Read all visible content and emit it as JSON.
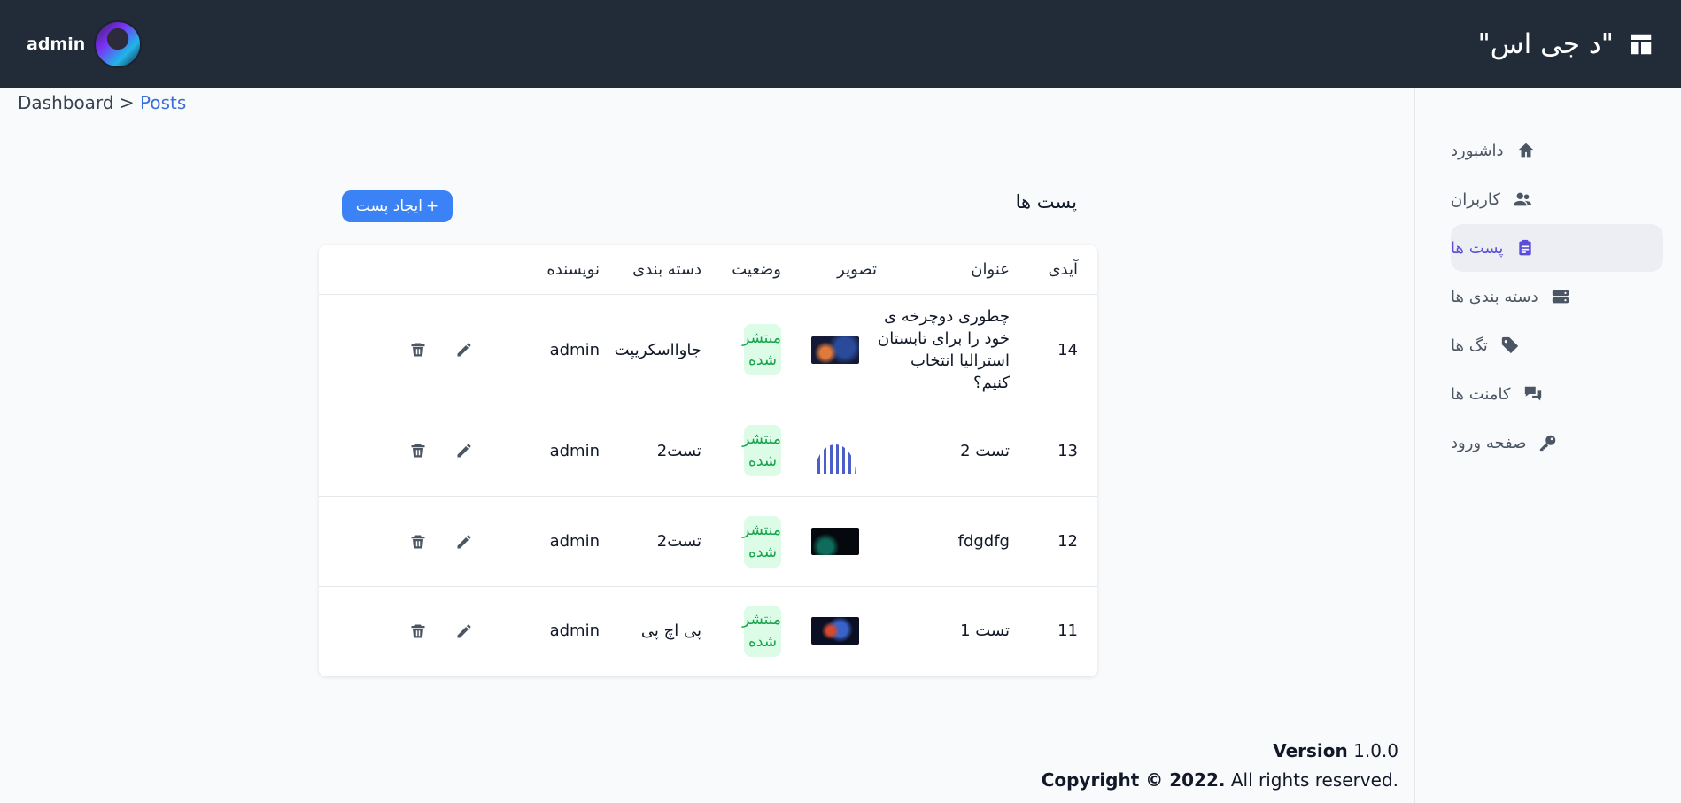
{
  "header": {
    "brand_title": "\"د جی اس\"",
    "user_name": "admin"
  },
  "sidebar": {
    "items": [
      {
        "label": "داشبورد",
        "icon": "home-icon"
      },
      {
        "label": "کاربران",
        "icon": "users-icon"
      },
      {
        "label": "پست ها",
        "icon": "clipboard-icon",
        "active": true
      },
      {
        "label": "دسته بندی ها",
        "icon": "server-icon"
      },
      {
        "label": "تگ ها",
        "icon": "tag-icon"
      },
      {
        "label": "کامنت ها",
        "icon": "chat-icon"
      },
      {
        "label": "صفحه ورود",
        "icon": "key-icon"
      }
    ]
  },
  "breadcrumb": {
    "root": "Dashboard",
    "separator": ">",
    "current": "Posts"
  },
  "main": {
    "title": "پست ها",
    "create_button": "ایجاد پست",
    "create_button_icon": "+",
    "columns": [
      "آیدی",
      "عنوان",
      "تصویر",
      "وضعیت",
      "دسته بندی",
      "نویسنده"
    ],
    "rows": [
      {
        "id": "14",
        "title": "چطوری دوچرخه ی خود را برای تابستان استرالیا انتخاب کنیم؟",
        "image": "galaxy-thumbnail",
        "status": "منتشر شده",
        "category": "جاوااسکریپت",
        "author": "admin"
      },
      {
        "id": "13",
        "title": "تست 2",
        "image": "bars-thumbnail",
        "status": "منتشر شده",
        "category": "تست2",
        "author": "admin"
      },
      {
        "id": "12",
        "title": "fdgdfg",
        "image": "dark-thumbnail",
        "status": "منتشر شده",
        "category": "تست2",
        "author": "admin"
      },
      {
        "id": "11",
        "title": "تست 1",
        "image": "nebula-thumbnail",
        "status": "منتشر شده",
        "category": "پی اچ پی",
        "author": "admin"
      }
    ]
  },
  "footer": {
    "version_label": "Version",
    "version_value": "1.0.0",
    "copyright_bold": "Copyright © 2022.",
    "copyright_rest": "All rights reserved."
  },
  "colors": {
    "header_bg": "#222b38",
    "accent": "#3b82f6",
    "active_nav": "#5b4dd6",
    "status_bg": "#dcfce7",
    "status_text": "#16a34a"
  }
}
